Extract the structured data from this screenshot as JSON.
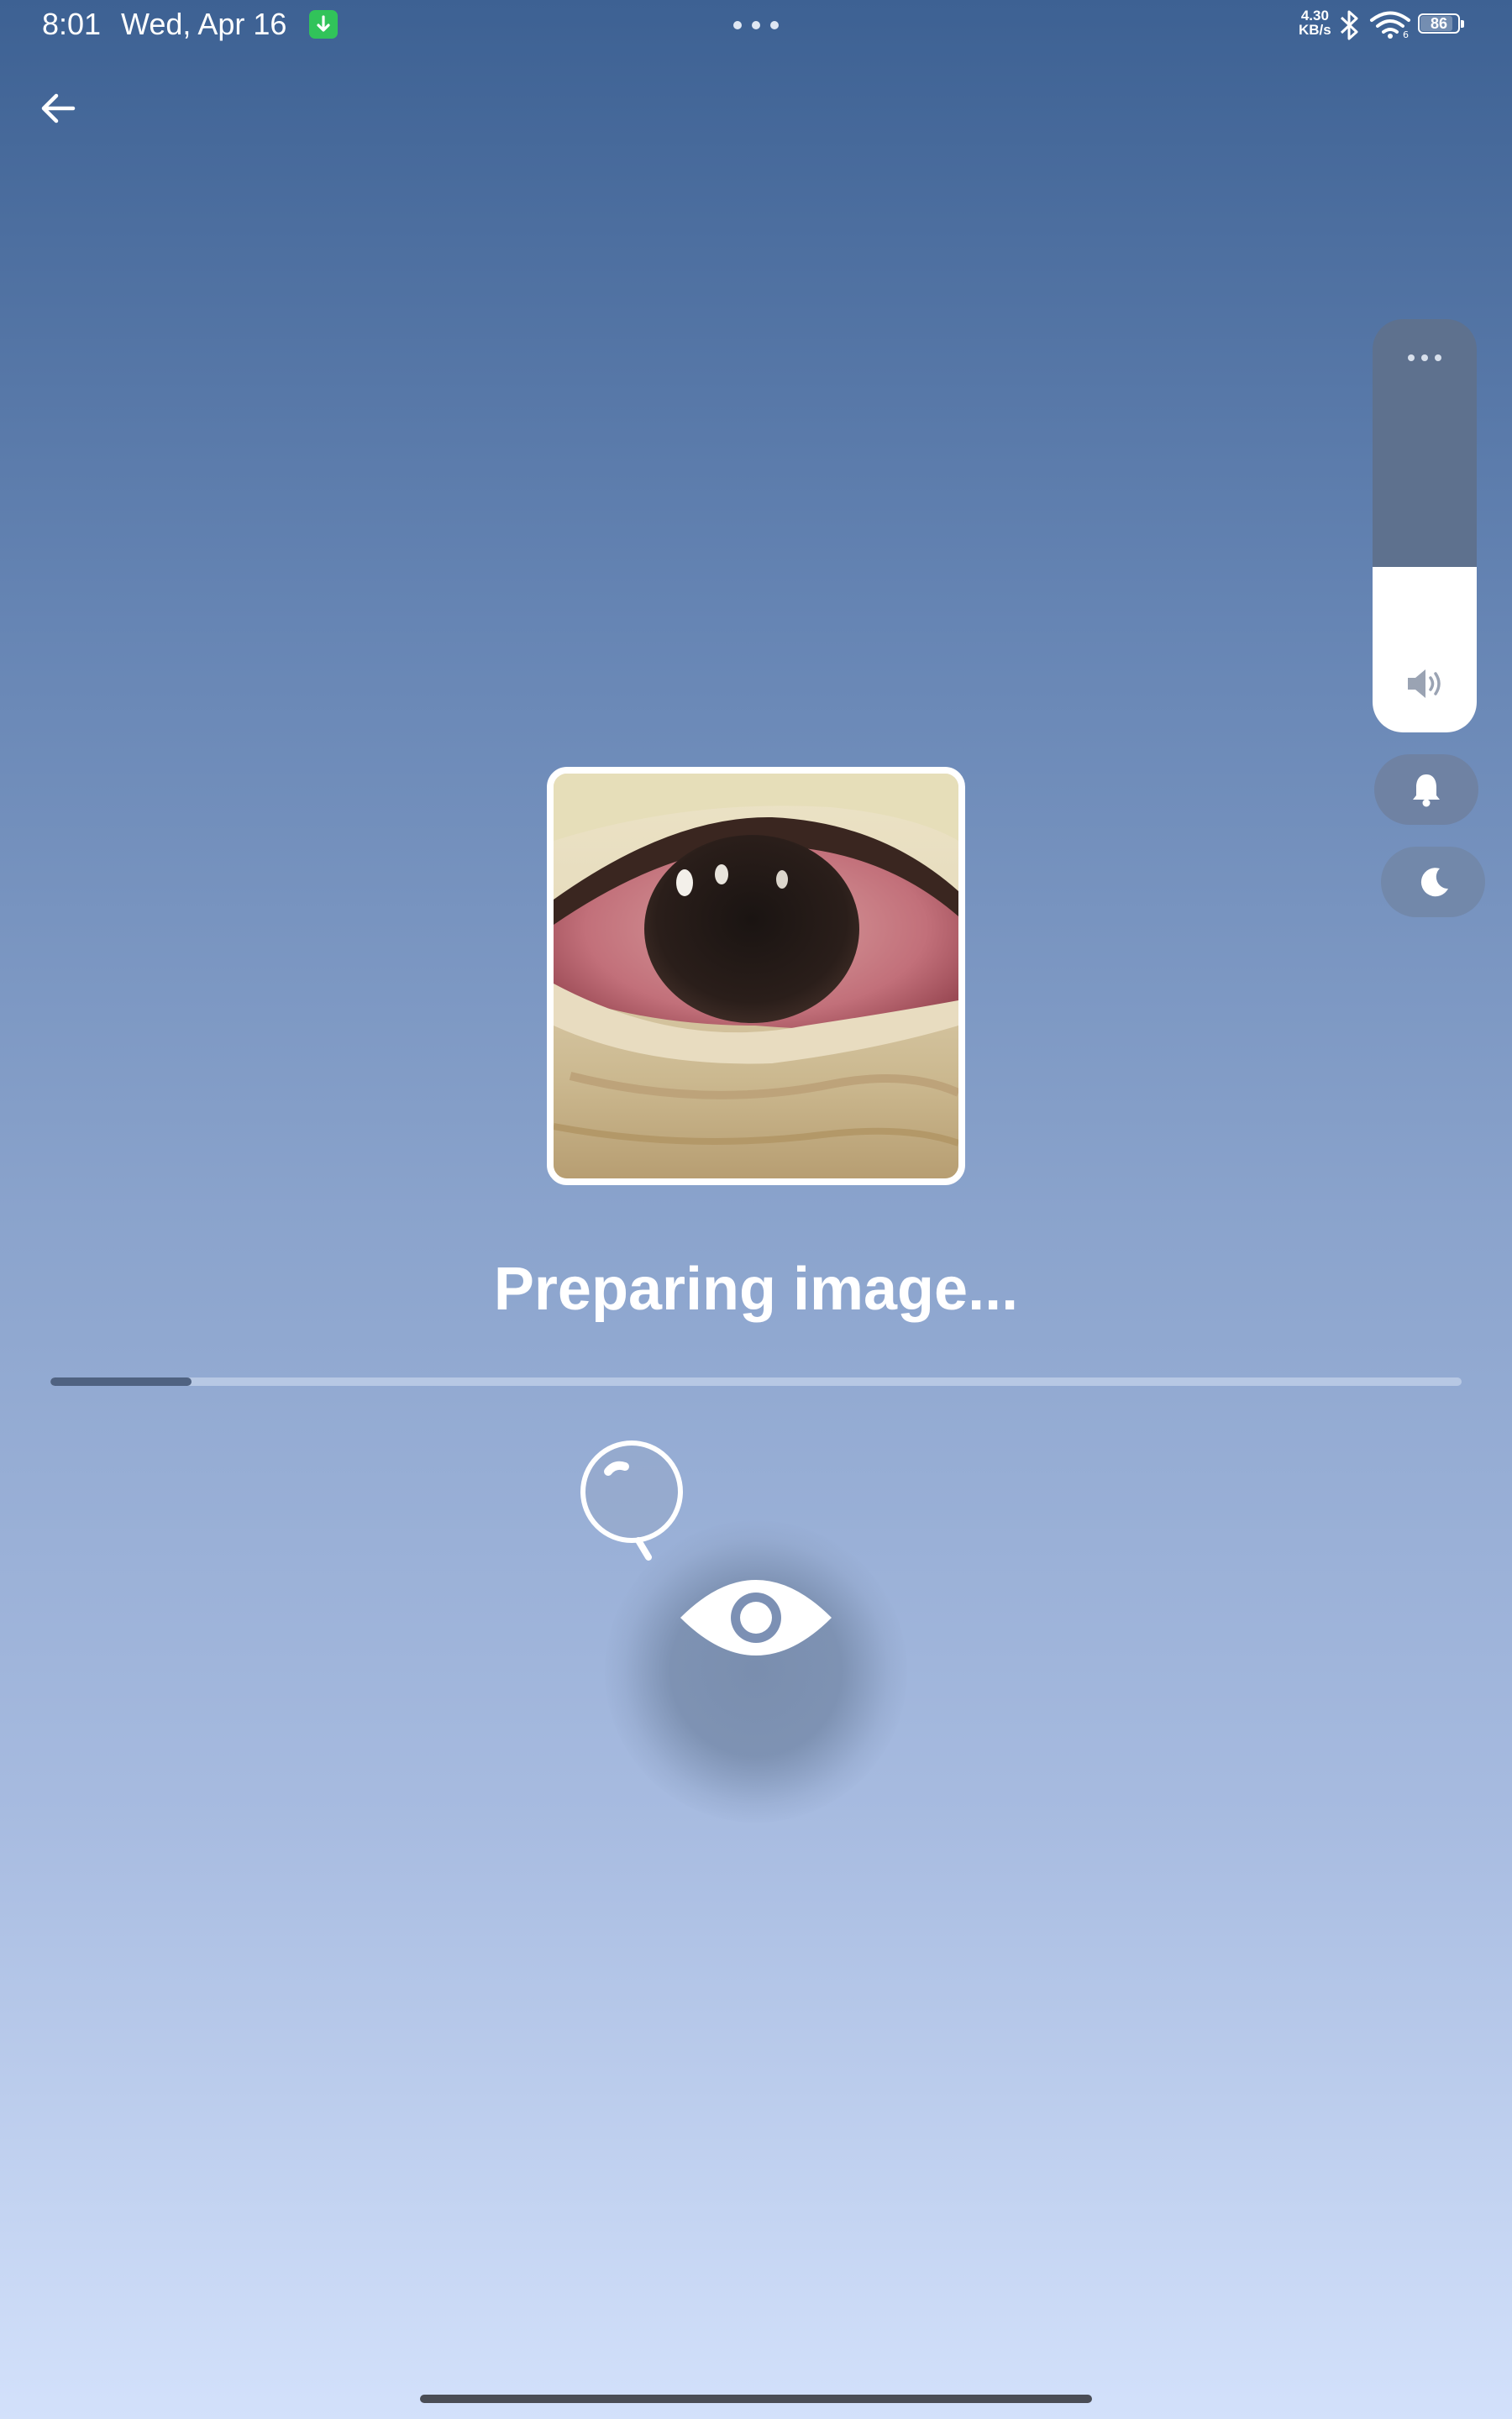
{
  "status_bar": {
    "time": "8:01",
    "date": "Wed, Apr 16",
    "net_speed_value": "4.30",
    "net_speed_unit": "KB/s",
    "battery": "86",
    "battery_level": 0.86,
    "download_badge_color": "#31c35a"
  },
  "header": {
    "back_icon": "arrow-left-icon"
  },
  "volume_panel": {
    "level": 0.4,
    "more_icon": "more-horizontal-icon",
    "speaker_icon": "speaker-icon",
    "ring_icon": "bell-icon",
    "dnd_icon": "moon-icon"
  },
  "preview": {
    "image_icon": "eye-photo-thumbnail"
  },
  "main": {
    "status_text": "Preparing image...",
    "progress": 0.1
  },
  "animation": {
    "magnifier_icon": "magnifier-icon",
    "eye_icon": "eye-icon"
  },
  "colors": {
    "background_top": "#3d6193",
    "background_bottom": "#d3e1fb",
    "progress_fill": "#4f6281",
    "progress_track": "#b7c8e4",
    "volume_panel": "#5e718e"
  }
}
